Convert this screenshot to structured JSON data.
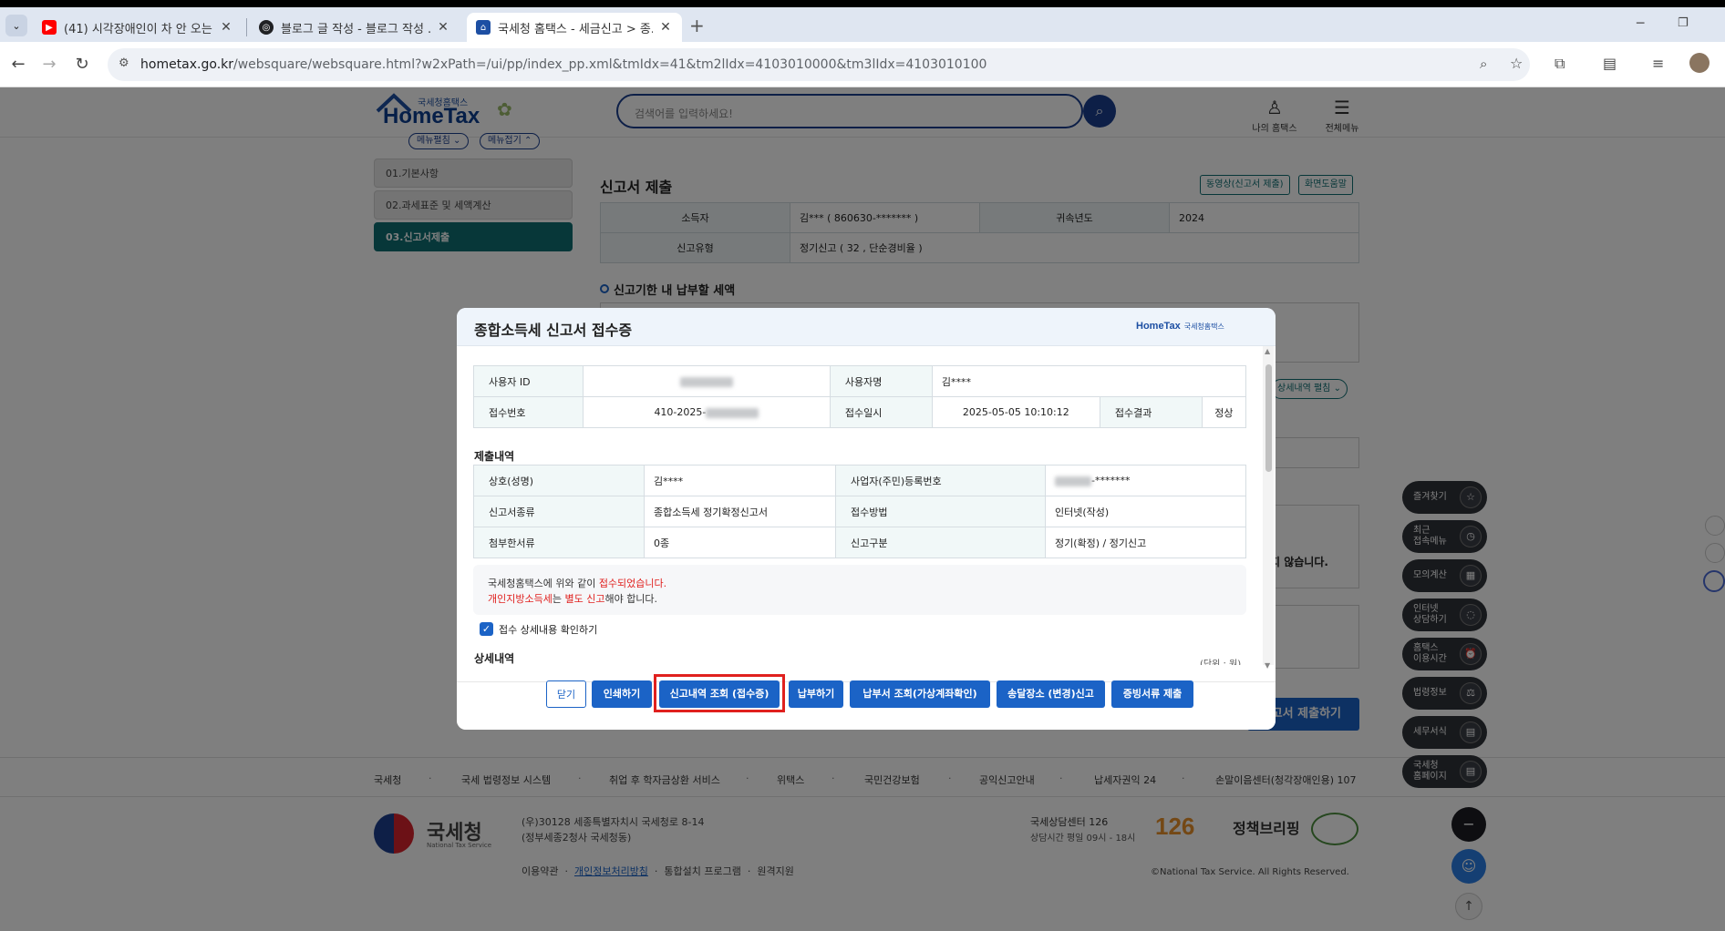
{
  "browser": {
    "tabs": [
      {
        "title": "(41) 시각장애인이 차 안 오는 ...",
        "icon": "youtube-icon",
        "color": "#ff0000"
      },
      {
        "title": "블로그 글 작성 - 블로그 작성 ...",
        "icon": "chatgpt-icon",
        "color": "#202124"
      },
      {
        "title": "국세청 홈택스 - 세금신고 > 종...",
        "icon": "hometax-icon",
        "color": "#1d4fa3"
      }
    ],
    "new_tab_label": "+",
    "url_domain": "hometax.go.kr",
    "url_path": "/websquare/websquare.html?w2xPath=/ui/pp/index_pp.xml&tmIdx=41&tm2lIdx=4103010000&tm3lIdx=4103010100"
  },
  "header": {
    "logo_small": "국세청홈택스",
    "logo_main": "HomeTax",
    "search_placeholder": "검색어를 입력하세요!",
    "my_hometax": "나의 홈택스",
    "all_menu": "전체메뉴"
  },
  "left_nav": {
    "expand_label": "메뉴펼침",
    "collapse_label": "메뉴접기",
    "items": [
      "01.기본사항",
      "02.과세표준 및 세액계산",
      "03.신고서제출"
    ]
  },
  "main": {
    "section_title": "신고서 제출",
    "video_button": "동영상(신고서 제출)",
    "help_button": "화면도움말",
    "info_rows": [
      {
        "label1": "소득자",
        "value1": "김*** ( 860630-******* )",
        "label2": "귀속년도",
        "value2": "2024"
      },
      {
        "label1": "신고유형",
        "value1": "정기신고 ( 32 , 단순경비율 )"
      }
    ],
    "tax_due_title": "신고기한 내 납부할 세액",
    "detail_toggle": "상세내역 펼침",
    "partial_text": "지 않습니다.",
    "submit_button": "신고서 제출하기"
  },
  "modal": {
    "title": "종합소득세 신고서 접수증",
    "logo_main": "HomeTax",
    "logo_sub": "국세청홈택스",
    "receipt": {
      "user_id_label": "사용자 ID",
      "user_name_label": "사용자명",
      "user_name": "김****",
      "receipt_no_label": "접수번호",
      "receipt_no_prefix": "410-2025-",
      "receipt_time_label": "접수일시",
      "receipt_time": "2025-05-05 10:10:12",
      "result_label": "접수결과",
      "result": "정상"
    },
    "submission_title": "제출내역",
    "submission": {
      "trade_name_label": "상호(성명)",
      "trade_name": "김****",
      "reg_no_label": "사업자(주민)등록번호",
      "reg_no_suffix": "-*******",
      "form_type_label": "신고서종류",
      "form_type": "종합소득세 정기확정신고서",
      "method_label": "접수방법",
      "method": "인터넷(작성)",
      "attach_label": "첨부한서류",
      "attach": "0종",
      "category_label": "신고구분",
      "category": "정기(확정) / 정기신고"
    },
    "notice": {
      "line1_a": "국세청홈택스에 위와 같이 ",
      "line1_b": "접수되었습니다.",
      "line2_a": "개인지방소득세",
      "line2_b": "는 ",
      "line2_c": "별도 신고",
      "line2_d": "해야 합니다."
    },
    "confirm_checkbox": "접수 상세내용 확인하기",
    "detail_title": "상세내역",
    "unit_label": "(단위 : 원)",
    "buttons": {
      "close": "닫기",
      "print": "인쇄하기",
      "history": "신고내역 조회 (접수증)",
      "pay": "납부하기",
      "bill": "납부서 조회(가상계좌확인)",
      "address": "송달장소 (변경)신고",
      "evidence": "증빙서류 제출"
    }
  },
  "footer": {
    "links": [
      "국세청",
      "국세 법령정보 시스템",
      "취업 후 학자금상환 서비스",
      "위택스",
      "국민건강보험",
      "공익신고안내",
      "납세자권익 24",
      "손말이음센터(청각장애인용) 107"
    ],
    "org_name": "국세청",
    "org_name_en": "National Tax Service",
    "address1": "(우)30128 세종특별자치시 국세청로 8-14",
    "address2": "(정부세종2청사 국세청동)",
    "bottom_links": [
      "이용약관",
      "개인정보처리방침",
      "통합설치 프로그램",
      "원격지원"
    ],
    "call_center": "국세상담센터 126",
    "call_hours": "상담시간 평일 09시 - 18시",
    "badge_126": "126",
    "policy_label": "정책브리핑",
    "copyright": "©National Tax Service. All Rights Reserved."
  },
  "fabs": [
    {
      "label": "즐겨찾기"
    },
    {
      "label": "최근\n접속메뉴"
    },
    {
      "label": "모의계산"
    },
    {
      "label": "인터넷\n상담하기"
    },
    {
      "label": "홈택스\n이용시간"
    },
    {
      "label": "법령정보"
    },
    {
      "label": "세무서식"
    },
    {
      "label": "국세청\n홈페이지"
    }
  ]
}
